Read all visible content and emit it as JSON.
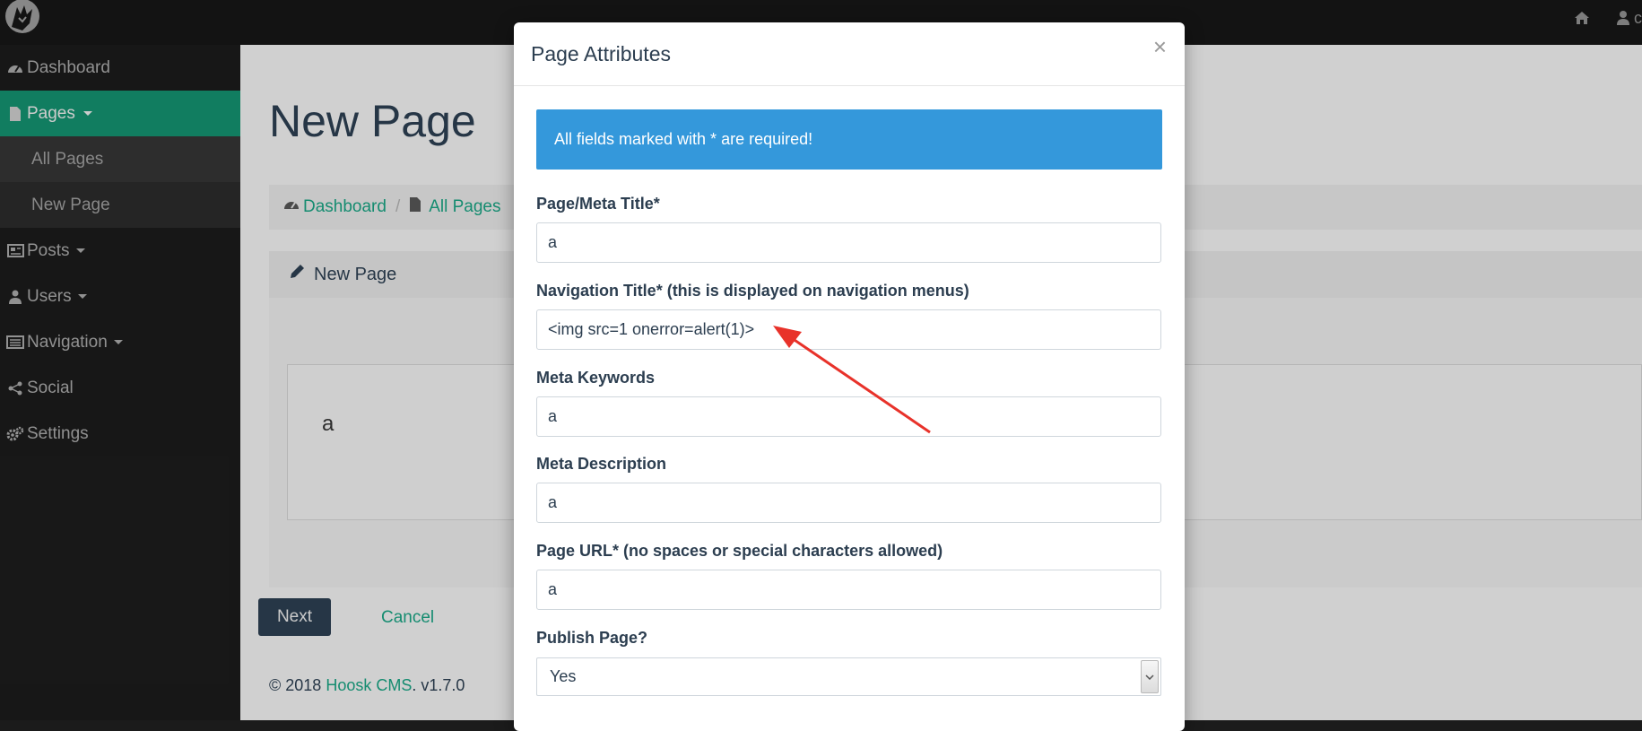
{
  "topbar": {
    "logo_icon": "wolf-logo-icon",
    "home_icon": "home-icon",
    "user_icon": "user-icon",
    "user_label": "c"
  },
  "sidebar": {
    "items": [
      {
        "label": "Dashboard",
        "icon": "dashboard-icon"
      },
      {
        "label": "Pages",
        "icon": "file-icon"
      },
      {
        "label": "All Pages"
      },
      {
        "label": "New Page"
      },
      {
        "label": "Posts",
        "icon": "newspaper-icon"
      },
      {
        "label": "Users",
        "icon": "user-icon"
      },
      {
        "label": "Navigation",
        "icon": "list-icon"
      },
      {
        "label": "Social",
        "icon": "share-icon"
      },
      {
        "label": "Settings",
        "icon": "cogs-icon"
      }
    ]
  },
  "main": {
    "title": "New Page",
    "breadcrumb": [
      {
        "label": "Dashboard",
        "icon": "dashboard-icon"
      },
      {
        "label": "All Pages",
        "icon": "file-icon"
      }
    ],
    "panel_title": "New Page",
    "editor_text": "a",
    "next_label": "Next",
    "cancel_label": "Cancel",
    "footer_prefix": "© 2018",
    "footer_link": "Hoosk CMS",
    "footer_version": ". v1.7.0"
  },
  "modal": {
    "title": "Page Attributes",
    "close_label": "×",
    "alert": "All fields marked with * are required!",
    "fields": [
      {
        "label": "Page/Meta Title*",
        "value": "a"
      },
      {
        "label": "Navigation Title* (this is displayed on navigation menus)",
        "value": "<img src=1 onerror=alert(1)>"
      },
      {
        "label": "Meta Keywords",
        "value": "a"
      },
      {
        "label": "Meta Description",
        "value": "a"
      },
      {
        "label": "Page URL* (no spaces or special characters allowed)",
        "value": "a"
      }
    ],
    "publish_label": "Publish Page?",
    "publish_value": "Yes"
  },
  "colors": {
    "accent": "#148f6e",
    "link": "#18a080",
    "alert_bg": "#3498db",
    "dark_text": "#2c3e50",
    "annotation_arrow": "#e8322a"
  }
}
